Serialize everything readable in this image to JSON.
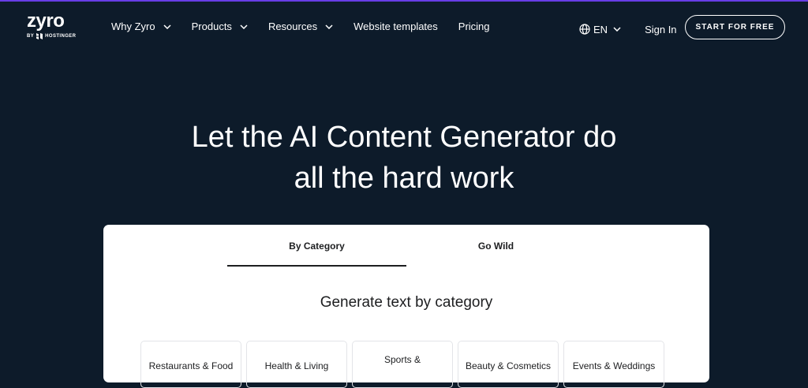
{
  "brand": {
    "name": "zyro",
    "byline": "BY",
    "parent": "HOSTINGER"
  },
  "nav": {
    "items": [
      {
        "label": "Why Zyro",
        "has_dropdown": true
      },
      {
        "label": "Products",
        "has_dropdown": true
      },
      {
        "label": "Resources",
        "has_dropdown": true
      },
      {
        "label": "Website templates",
        "has_dropdown": false
      },
      {
        "label": "Pricing",
        "has_dropdown": false
      }
    ],
    "language": "EN",
    "signin": "Sign In",
    "cta": "START FOR FREE"
  },
  "hero": {
    "title_line1": "Let the AI Content Generator do",
    "title_line2": "all the hard work"
  },
  "card": {
    "tabs": [
      {
        "label": "By Category",
        "active": true
      },
      {
        "label": "Go Wild",
        "active": false
      }
    ],
    "heading": "Generate text by category",
    "categories": [
      "Restaurants & Food",
      "Health & Living",
      "Sports &",
      "Beauty & Cosmetics",
      "Events & Weddings"
    ]
  },
  "colors": {
    "background": "#0d1b2a",
    "accent": "#673de6",
    "card": "#ffffff",
    "text_dark": "#1d1e20"
  },
  "icons": {
    "lang": "globe-icon",
    "dropdown": "chevron-down-icon"
  }
}
